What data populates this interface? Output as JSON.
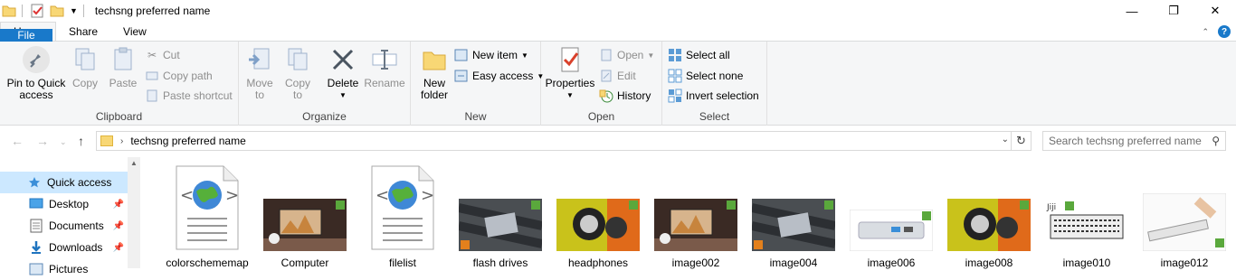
{
  "window": {
    "title": "techsng preferred name",
    "controls": {
      "minimize": "—",
      "maximize": "❐",
      "close": "✕"
    }
  },
  "ribbon_tabs": [
    "File",
    "Home",
    "Share",
    "View"
  ],
  "ribbon": {
    "clipboard": {
      "label": "Clipboard",
      "pin": [
        "Pin to Quick",
        "access"
      ],
      "copy": "Copy",
      "paste": "Paste",
      "cut": "Cut",
      "copy_path": "Copy path",
      "paste_shortcut": "Paste shortcut"
    },
    "organize": {
      "label": "Organize",
      "move_to": [
        "Move",
        "to"
      ],
      "copy_to": [
        "Copy",
        "to"
      ],
      "delete": "Delete",
      "rename": "Rename"
    },
    "new": {
      "label": "New",
      "new_folder": [
        "New",
        "folder"
      ],
      "new_item": "New item",
      "easy_access": "Easy access"
    },
    "open": {
      "label": "Open",
      "properties": "Properties",
      "open": "Open",
      "edit": "Edit",
      "history": "History"
    },
    "select": {
      "label": "Select",
      "select_all": "Select all",
      "select_none": "Select none",
      "invert_selection": "Invert selection"
    }
  },
  "address": {
    "path": "techsng preferred name",
    "search_placeholder": "Search techsng preferred name"
  },
  "nav_pane": [
    {
      "label": "Quick access",
      "icon": "star-icon",
      "selected": true,
      "pinned": false
    },
    {
      "label": "Desktop",
      "icon": "desktop-icon",
      "selected": false,
      "pinned": true
    },
    {
      "label": "Documents",
      "icon": "documents-icon",
      "selected": false,
      "pinned": true
    },
    {
      "label": "Downloads",
      "icon": "downloads-icon",
      "selected": false,
      "pinned": true
    },
    {
      "label": "Pictures",
      "icon": "pictures-icon",
      "selected": false,
      "pinned": true
    }
  ],
  "files": [
    {
      "name": "colorschememap",
      "type": "xml"
    },
    {
      "name": "Computer",
      "type": "photo-desk"
    },
    {
      "name": "filelist",
      "type": "xml"
    },
    {
      "name": "flash drives",
      "type": "photo-keyboard"
    },
    {
      "name": "headphones",
      "type": "photo-headphones"
    },
    {
      "name": "image002",
      "type": "photo-desk"
    },
    {
      "name": "image004",
      "type": "photo-keyboard"
    },
    {
      "name": "image006",
      "type": "photo-hub"
    },
    {
      "name": "image008",
      "type": "photo-headphones"
    },
    {
      "name": "image010",
      "type": "photo-whitekeyboard"
    },
    {
      "name": "image012",
      "type": "photo-scanner"
    }
  ],
  "colors": {
    "accent": "#1979ca",
    "ribbon_bg": "#f5f6f7",
    "selected_bg": "#cce8ff"
  }
}
